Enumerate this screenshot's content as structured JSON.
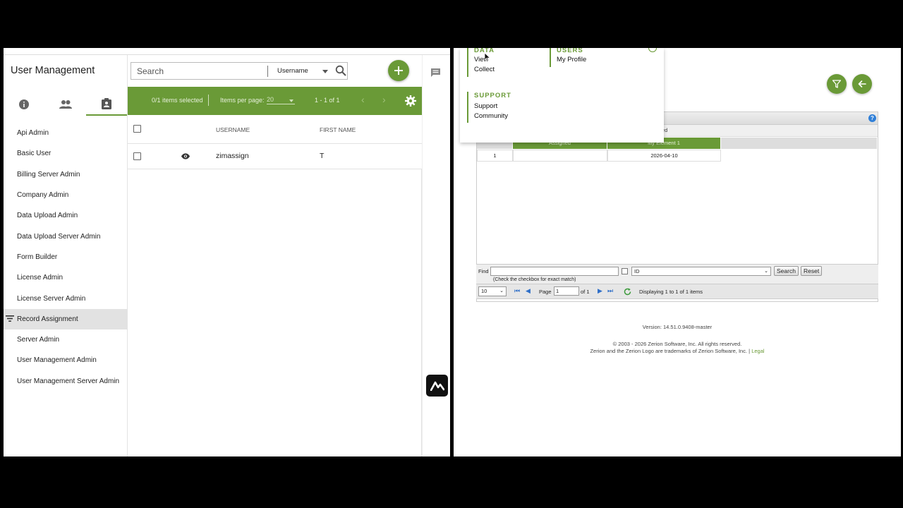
{
  "left_app": {
    "title": "User Management",
    "search": {
      "placeholder": "Search",
      "field": "Username"
    },
    "toolbar": {
      "selected": "0/1 items selected",
      "items_per_page_label": "Items per page:",
      "items_per_page": "20",
      "range": "1 - 1 of 1"
    },
    "columns": [
      "USERNAME",
      "FIRST NAME"
    ],
    "rows": [
      {
        "username": "zimassign",
        "first_name": "T"
      }
    ],
    "roles": [
      "Api Admin",
      "Basic User",
      "Billing Server Admin",
      "Company Admin",
      "Data Upload Admin",
      "Data Upload Server Admin",
      "Form Builder",
      "License Admin",
      "License Server Admin",
      "Record Assignment",
      "Server Admin",
      "User Management Admin",
      "User Management Server Admin"
    ],
    "active_role": "Record Assignment"
  },
  "right_app": {
    "menu": {
      "data": {
        "heading": "DATA",
        "links": [
          "View",
          "Collect"
        ]
      },
      "users": {
        "heading": "USERS",
        "links": [
          "My Profile"
        ]
      },
      "support": {
        "heading": "SUPPORT",
        "links": [
          "Support",
          "Community"
        ]
      }
    },
    "panel": {
      "sub_text": "ected",
      "columns": [
        "Assigned",
        "My Element 1"
      ],
      "rows": [
        {
          "num": "1",
          "assigned": "",
          "element": "2026-04-10"
        }
      ]
    },
    "find": {
      "label": "Find",
      "hint": "(Check the checkbox for exact match)",
      "field": "ID",
      "search_btn": "Search",
      "reset_btn": "Reset"
    },
    "pager": {
      "page_size": "10",
      "page_label": "Page",
      "page": "1",
      "of": "of 1",
      "display": "Displaying 1 to 1 of 1 items"
    },
    "footer": {
      "version": "Version: 14.51.0.9408-master",
      "copyright": "© 2003 - 2026 Zerion Software, Inc. All rights reserved.",
      "trademark": "Zerion and the Zerion Logo are trademarks of Zerion Software, Inc. |",
      "legal": "Legal"
    }
  },
  "colors": {
    "accent": "#6a9a37",
    "link_blue": "#2f6fc8"
  }
}
